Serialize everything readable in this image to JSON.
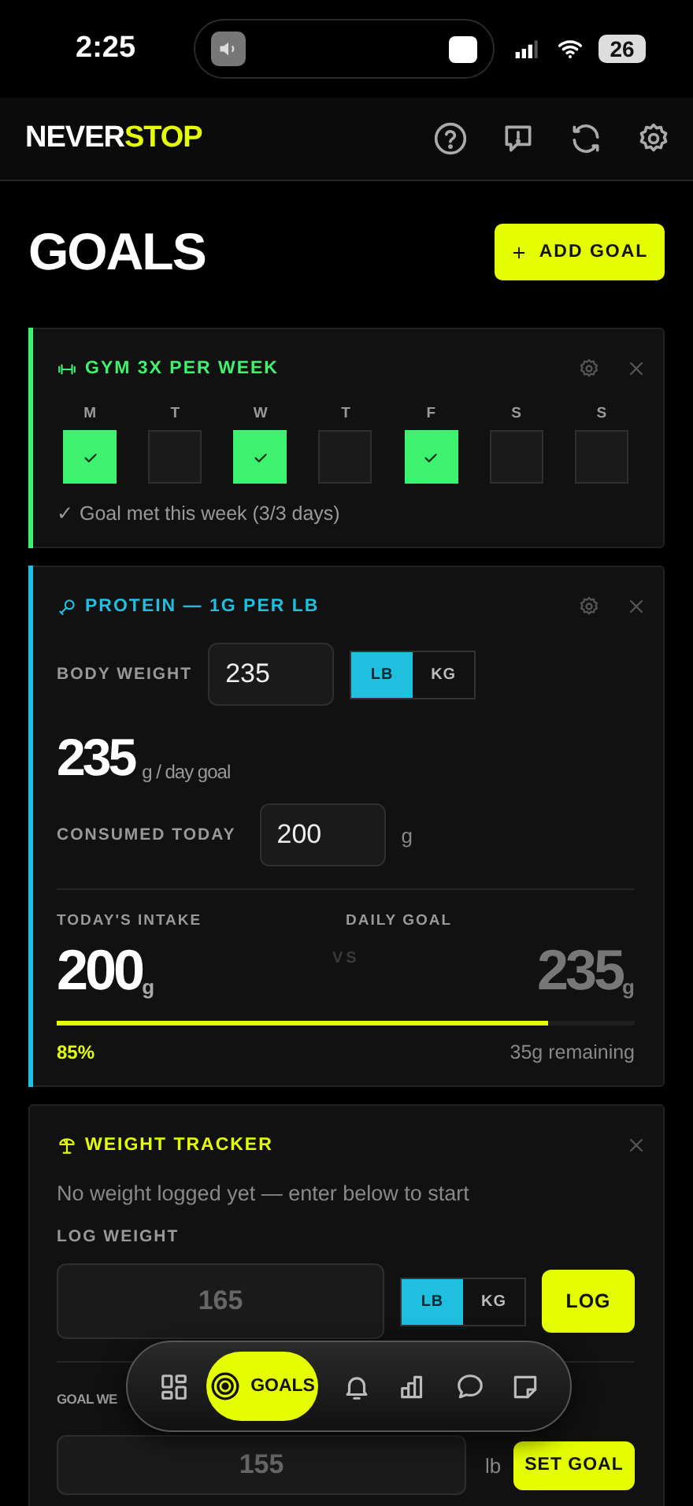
{
  "status_bar": {
    "time": "2:25",
    "battery": "26"
  },
  "header": {
    "logo": {
      "first": "NEVER",
      "second": "STOP"
    }
  },
  "page": {
    "title": "GOALS",
    "add_button": "ADD GOAL"
  },
  "goals": [
    {
      "kind": "weekly",
      "color": "#3ef26f",
      "title": "GYM 3X PER WEEK",
      "days": [
        {
          "label": "M",
          "checked": true
        },
        {
          "label": "T",
          "checked": false
        },
        {
          "label": "W",
          "checked": true
        },
        {
          "label": "T",
          "checked": false
        },
        {
          "label": "F",
          "checked": true
        },
        {
          "label": "S",
          "checked": false
        },
        {
          "label": "S",
          "checked": false
        }
      ],
      "summary": "✓ Goal met this week (3/3 days)"
    },
    {
      "kind": "protein",
      "color": "#1fbfdf",
      "title": "PROTEIN — 1G PER LB",
      "body_weight": {
        "label": "BODY WEIGHT",
        "value": "235"
      },
      "units": [
        {
          "label": "LB",
          "selected": true
        },
        {
          "label": "KG",
          "selected": false
        }
      ],
      "goal_value": "235",
      "goal_unit": "g / day goal",
      "consumed": {
        "label": "CONSUMED TODAY",
        "value": "200",
        "unit": "g"
      },
      "intake": {
        "label": "TODAY'S INTAKE",
        "value": "200",
        "unit": "g"
      },
      "vs": "VS",
      "daily_goal": {
        "label": "DAILY GOAL",
        "value": "235",
        "unit": "g"
      },
      "progress": {
        "level": 0.85,
        "percent": "85%",
        "remaining": "35g remaining"
      }
    },
    {
      "kind": "weight",
      "color": "#e5ff00",
      "title": "WEIGHT TRACKER",
      "message": "No weight logged yet — enter below to start",
      "log": {
        "label": "LOG WEIGHT",
        "placeholder": "165",
        "units": [
          {
            "label": "LB",
            "selected": true
          },
          {
            "label": "KG",
            "selected": false
          }
        ],
        "button": "LOG"
      },
      "goal": {
        "label": "GOAL WE",
        "placeholder": "155",
        "unit": "lb",
        "button": "SET GOAL"
      }
    }
  ],
  "bottom_nav": [
    {
      "kind": "dashboard",
      "selected": false
    },
    {
      "kind": "goals",
      "label": "GOALS",
      "selected": true
    },
    {
      "kind": "alerts",
      "selected": false
    },
    {
      "kind": "stats",
      "selected": false
    },
    {
      "kind": "chat",
      "selected": false
    },
    {
      "kind": "notes",
      "selected": false
    }
  ]
}
